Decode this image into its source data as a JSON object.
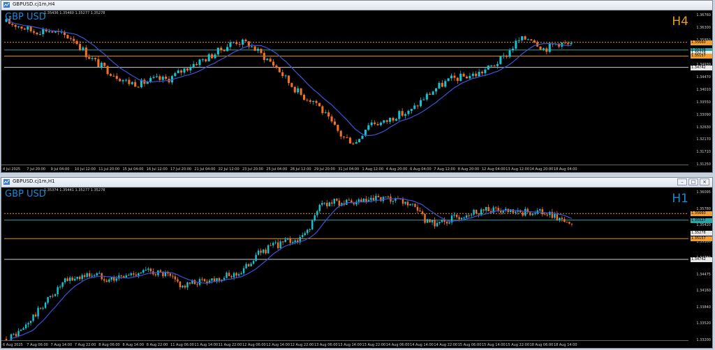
{
  "colors": {
    "bull": "#19c0d0",
    "bear": "#f07026",
    "ma": "#3c54d8",
    "hline_white": "#cfcfcf",
    "hline_orange": "#e8921f",
    "hline_green": "#2aa5a5",
    "dotted": "#e8921f",
    "tag_orange": "#f0a030",
    "tag_white": "#e8e8e8",
    "tag_green": "#2aa5a5"
  },
  "windows": [
    {
      "title": "GBPUSD.cj1m,H4",
      "symbol": "GBP USD",
      "timeframe": "H4",
      "ohlc": "1.35436 1.35460 1.35277 1.35278",
      "price_labels": [
        "1.36760",
        "1.36300",
        "1.35850",
        "1.35400",
        "1.34930",
        "1.34470",
        "1.34010",
        "1.33550",
        "1.33090",
        "1.32630",
        "1.32170",
        "1.31710",
        "1.31250"
      ],
      "time_labels": [
        "4 Jul 2025",
        "7 Jul 20:00",
        "9 Jul 04:00",
        "10 Jul 12:00",
        "11 Jul 20:00",
        "15 Jul 04:00",
        "16 Jul 12:00",
        "17 Jul 20:00",
        "21 Jul 04:00",
        "22 Jul 12:00",
        "23 Jul 20:00",
        "25 Jul 04:00",
        "28 Jul 12:00",
        "29 Jul 20:00",
        "31 Jul 04:00",
        "1 Aug 12:00",
        "4 Aug 20:00",
        "6 Aug 04:00",
        "7 Aug 12:00",
        "8 Aug 20:00",
        "12 Aug 04:00",
        "13 Aug 12:00",
        "14 Aug 20:00",
        "18 Aug 04:00"
      ],
      "price_tags": [
        {
          "text": "1.35660",
          "kind": "tag_orange",
          "price": 1.3566
        },
        {
          "text": "1.35376",
          "kind": "tag_green",
          "price": 1.35376
        },
        {
          "text": "1.35278",
          "kind": "tag_white",
          "price": 1.35278
        },
        {
          "text": "1.35157",
          "kind": "tag_orange",
          "price": 1.35157
        },
        {
          "text": "1.34742",
          "kind": "tag_white",
          "price": 1.34742
        }
      ],
      "hlines": [
        {
          "price": 1.3566,
          "kind": "dotted"
        },
        {
          "price": 1.35376,
          "kind": "hline_green"
        },
        {
          "price": 1.35157,
          "kind": "hline_orange"
        },
        {
          "price": 1.34742,
          "kind": "hline_white"
        }
      ],
      "ylim": [
        1.3112,
        1.3682
      ],
      "path": [
        [
          0,
          1.364
        ],
        [
          4,
          1.3625
        ],
        [
          8,
          1.3605
        ],
        [
          12,
          1.3612
        ],
        [
          16,
          1.3595
        ],
        [
          20,
          1.358
        ],
        [
          24,
          1.352
        ],
        [
          28,
          1.348
        ],
        [
          32,
          1.345
        ],
        [
          36,
          1.342
        ],
        [
          40,
          1.3415
        ],
        [
          44,
          1.343
        ],
        [
          48,
          1.343
        ],
        [
          52,
          1.346
        ],
        [
          56,
          1.349
        ],
        [
          60,
          1.351
        ],
        [
          64,
          1.354
        ],
        [
          68,
          1.357
        ],
        [
          72,
          1.356
        ],
        [
          76,
          1.352
        ],
        [
          80,
          1.348
        ],
        [
          84,
          1.342
        ],
        [
          88,
          1.337
        ],
        [
          92,
          1.335
        ],
        [
          96,
          1.328
        ],
        [
          100,
          1.322
        ],
        [
          104,
          1.32
        ],
        [
          108,
          1.3275
        ],
        [
          112,
          1.327
        ],
        [
          116,
          1.33
        ],
        [
          120,
          1.331
        ],
        [
          124,
          1.336
        ],
        [
          128,
          1.34
        ],
        [
          132,
          1.343
        ],
        [
          136,
          1.344
        ],
        [
          140,
          1.345
        ],
        [
          144,
          1.3475
        ],
        [
          148,
          1.351
        ],
        [
          152,
          1.357
        ],
        [
          156,
          1.3585
        ],
        [
          160,
          1.354
        ],
        [
          164,
          1.3565
        ],
        [
          168,
          1.3553
        ]
      ],
      "n_bars": 185
    },
    {
      "title": "GBPUSD.cj1m,H1",
      "symbol": "GBP USD",
      "timeframe": "H1",
      "ohlc": "1.35374 1.35441 1.35277 1.35278",
      "price_labels": [
        "1.36095",
        "1.35780",
        "1.35420",
        "1.35100",
        "1.34780",
        "1.34475",
        "1.34160",
        "1.33840",
        "1.33520",
        "1.33200"
      ],
      "time_labels": [
        "6 Aug 2025",
        "7 Aug 06:00",
        "7 Aug 14:00",
        "7 Aug 22:00",
        "8 Aug 06:00",
        "8 Aug 14:00",
        "8 Aug 22:00",
        "11 Aug 06:00",
        "11 Aug 14:00",
        "11 Aug 22:00",
        "12 Aug 06:00",
        "12 Aug 14:00",
        "12 Aug 22:00",
        "13 Aug 06:00",
        "13 Aug 14:00",
        "13 Aug 22:00",
        "14 Aug 06:00",
        "14 Aug 14:00",
        "14 Aug 22:00",
        "15 Aug 06:00",
        "15 Aug 14:00",
        "15 Aug 22:00",
        "18 Aug 06:00",
        "18 Aug 14:00"
      ],
      "price_tags": [
        {
          "text": "1.35660",
          "kind": "tag_orange",
          "price": 1.3566
        },
        {
          "text": "1.35527",
          "kind": "tag_green",
          "price": 1.35527
        },
        {
          "text": "1.35278",
          "kind": "tag_white",
          "price": 1.35278
        },
        {
          "text": "1.35157",
          "kind": "tag_orange",
          "price": 1.35157
        },
        {
          "text": "1.34742",
          "kind": "tag_white",
          "price": 1.34742
        }
      ],
      "hlines": [
        {
          "price": 1.3566,
          "kind": "dotted"
        },
        {
          "price": 1.35527,
          "kind": "hline_green"
        },
        {
          "price": 1.35157,
          "kind": "hline_orange"
        },
        {
          "price": 1.34742,
          "kind": "hline_white"
        }
      ],
      "ylim": [
        1.3308,
        1.3618
      ],
      "path": [
        [
          0,
          1.3315
        ],
        [
          6,
          1.333
        ],
        [
          12,
          1.3365
        ],
        [
          18,
          1.34
        ],
        [
          24,
          1.343
        ],
        [
          30,
          1.344
        ],
        [
          36,
          1.3445
        ],
        [
          42,
          1.3435
        ],
        [
          48,
          1.344
        ],
        [
          54,
          1.345
        ],
        [
          60,
          1.345
        ],
        [
          66,
          1.344
        ],
        [
          72,
          1.342
        ],
        [
          78,
          1.343
        ],
        [
          84,
          1.3435
        ],
        [
          90,
          1.344
        ],
        [
          96,
          1.345
        ],
        [
          102,
          1.3485
        ],
        [
          108,
          1.35
        ],
        [
          114,
          1.351
        ],
        [
          120,
          1.3515
        ],
        [
          124,
          1.3545
        ],
        [
          128,
          1.3585
        ],
        [
          134,
          1.359
        ],
        [
          140,
          1.3585
        ],
        [
          146,
          1.359
        ],
        [
          152,
          1.3595
        ],
        [
          158,
          1.359
        ],
        [
          164,
          1.3585
        ],
        [
          168,
          1.3565
        ],
        [
          172,
          1.3545
        ],
        [
          178,
          1.355
        ],
        [
          184,
          1.356
        ],
        [
          190,
          1.357
        ],
        [
          196,
          1.3575
        ],
        [
          202,
          1.357
        ],
        [
          208,
          1.3565
        ],
        [
          214,
          1.357
        ],
        [
          220,
          1.3565
        ],
        [
          226,
          1.3555
        ],
        [
          230,
          1.354
        ]
      ],
      "n_bars": 232
    }
  ]
}
